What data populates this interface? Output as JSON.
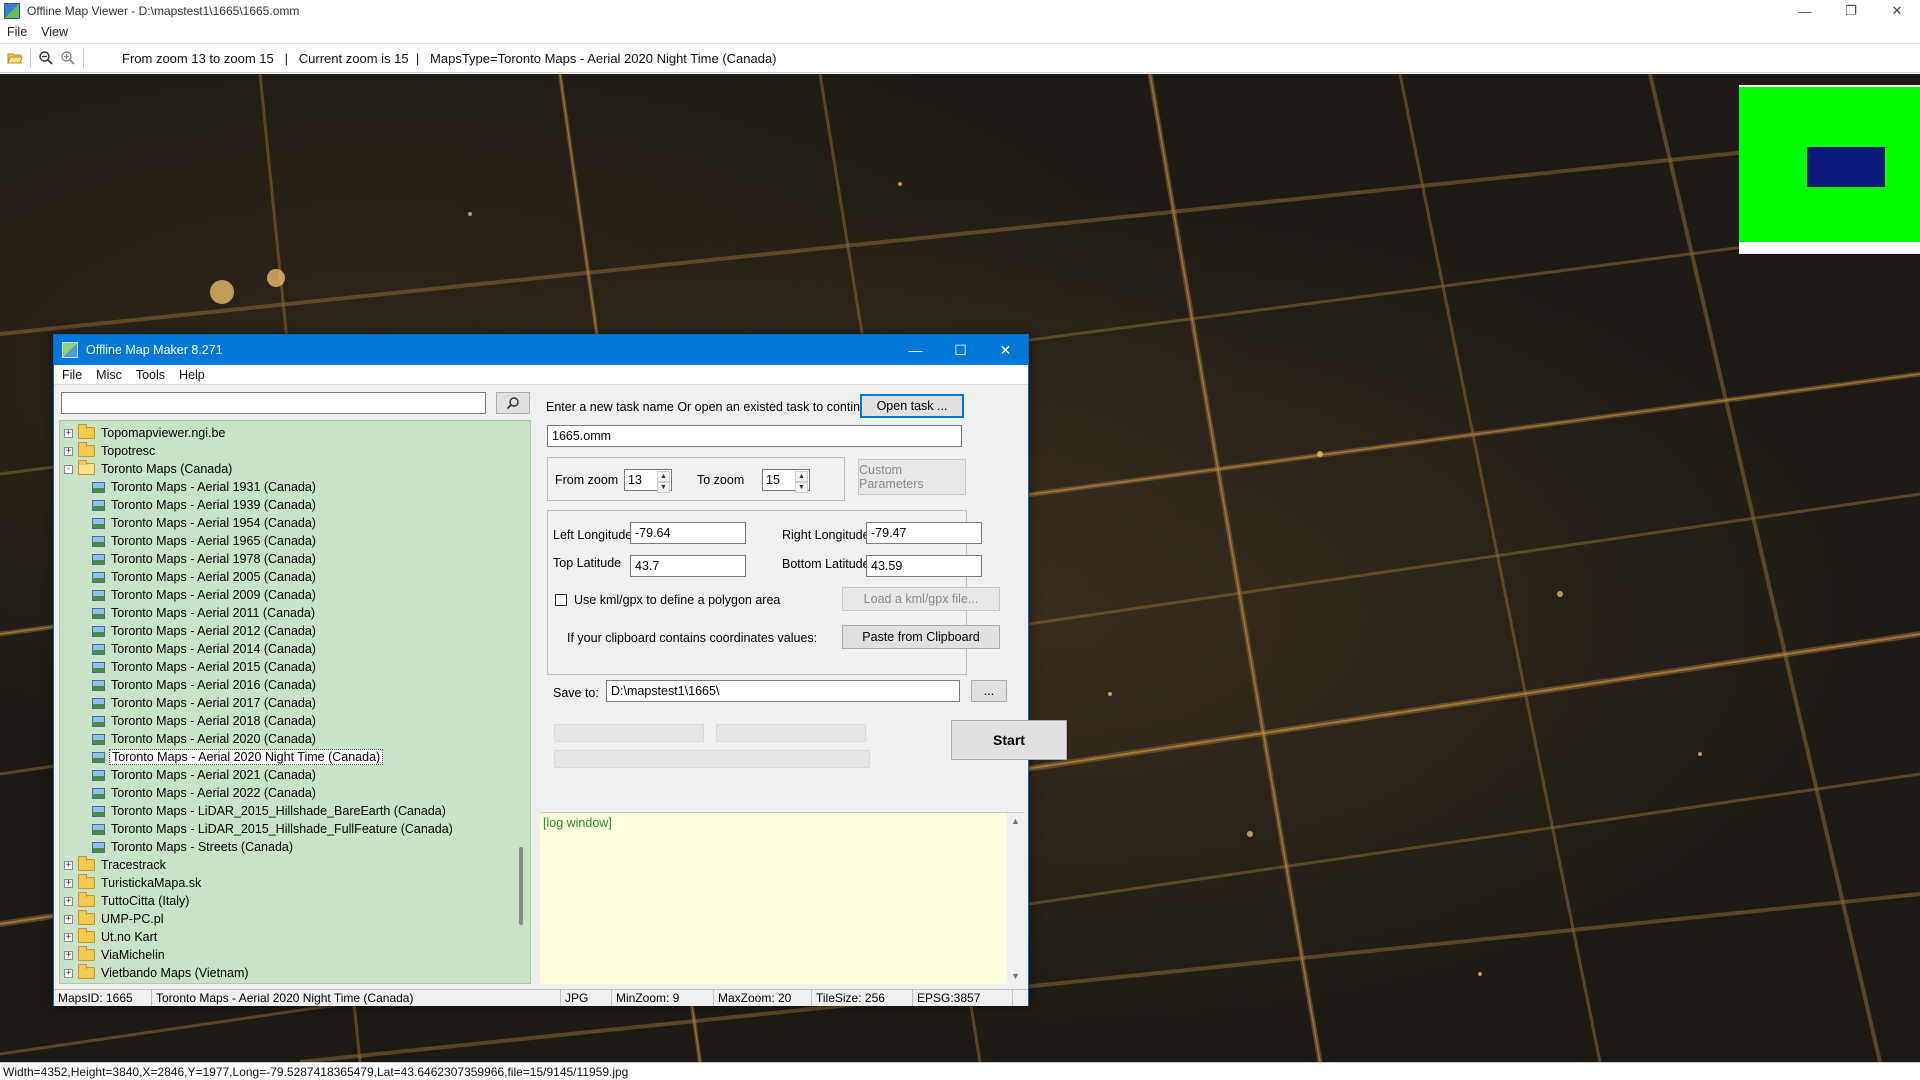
{
  "viewer": {
    "title": "Offline Map Viewer - D:\\mapstest1\\1665\\1665.omm",
    "menu": [
      "File",
      "View"
    ],
    "toolbar_text": "From zoom 13 to zoom 15   |   Current zoom is 15  |   MapsType=Toronto Maps - Aerial 2020 Night Time (Canada)",
    "status": "Width=4352,Height=3840,X=2846,Y=1977,Long=-79.5287418365479,Lat=43.6462307359966,file=15/9145/11959.jpg",
    "icons": [
      "open-folder-icon",
      "zoom-out-icon",
      "zoom-in-icon"
    ],
    "colors": {
      "minimap_bg": "#00ff00",
      "minimap_view": "#0b1a78",
      "map_bg": "#1d1a15"
    }
  },
  "maker": {
    "title": "Offline Map Maker 8.271",
    "menu": [
      "File",
      "Misc",
      "Tools",
      "Help"
    ],
    "search": {
      "value": "",
      "placeholder": ""
    },
    "tree": {
      "top_folders": [
        "Topomapviewer.ngi.be",
        "Topotresc"
      ],
      "open_folder": "Toronto Maps (Canada)",
      "children": [
        "Toronto Maps - Aerial 1931 (Canada)",
        "Toronto Maps - Aerial 1939 (Canada)",
        "Toronto Maps - Aerial 1954 (Canada)",
        "Toronto Maps - Aerial 1965 (Canada)",
        "Toronto Maps - Aerial 1978 (Canada)",
        "Toronto Maps - Aerial 2005 (Canada)",
        "Toronto Maps - Aerial 2009 (Canada)",
        "Toronto Maps - Aerial 2011 (Canada)",
        "Toronto Maps - Aerial 2012 (Canada)",
        "Toronto Maps - Aerial 2014 (Canada)",
        "Toronto Maps - Aerial 2015 (Canada)",
        "Toronto Maps - Aerial 2016 (Canada)",
        "Toronto Maps - Aerial 2017 (Canada)",
        "Toronto Maps - Aerial 2018 (Canada)",
        "Toronto Maps - Aerial 2020 (Canada)",
        "Toronto Maps - Aerial 2020 Night Time (Canada)",
        "Toronto Maps - Aerial 2021 (Canada)",
        "Toronto Maps - Aerial 2022 (Canada)",
        "Toronto Maps - LiDAR_2015_Hillshade_BareEarth (Canada)",
        "Toronto Maps - LiDAR_2015_Hillshade_FullFeature (Canada)",
        "Toronto Maps - Streets (Canada)"
      ],
      "selected_child": "Toronto Maps - Aerial 2020 Night Time (Canada)",
      "bottom_folders": [
        "Tracestrack",
        "TuristickaMapa.sk",
        "TuttoCitta (Italy)",
        "UMP-PC.pl",
        "Ut.no Kart",
        "ViaMichelin",
        "Vietbando Maps (Vietnam)"
      ]
    },
    "task": {
      "prompt": "Enter a new task name Or open an existed task to continue:",
      "open_button": "Open task ...",
      "name_value": "1665.omm"
    },
    "zoom": {
      "from_label": "From zoom",
      "from_value": "13",
      "to_label": "To zoom",
      "to_value": "15",
      "custom_button": "Custom Parameters"
    },
    "coords": {
      "left_lon_label": "Left Longitude",
      "left_lon_value": "-79.64",
      "right_lon_label": "Right Longitude",
      "right_lon_value": "-79.47",
      "top_lat_label": "Top Latitude",
      "top_lat_value": "43.7",
      "bottom_lat_label": "Bottom Latitude",
      "bottom_lat_value": "43.59",
      "kml_label": "Use kml/gpx to define a polygon area",
      "kml_checked": false,
      "kml_button": "Load a kml/gpx file...",
      "clipboard_label": "If your clipboard contains coordinates values:",
      "clipboard_button": "Paste from Clipboard"
    },
    "save": {
      "label": "Save to:",
      "value": "D:\\mapstest1\\1665\\",
      "browse_button": "...",
      "start_button": "Start"
    },
    "log_text": "[log window]",
    "status": {
      "maps_id": "MapsID: 1665",
      "map_name": "Toronto Maps - Aerial 2020 Night Time (Canada)",
      "format": "JPG",
      "min_zoom": "MinZoom: 9",
      "max_zoom": "MaxZoom: 20",
      "tile_size": "TileSize: 256",
      "epsg": "EPSG:3857"
    }
  }
}
